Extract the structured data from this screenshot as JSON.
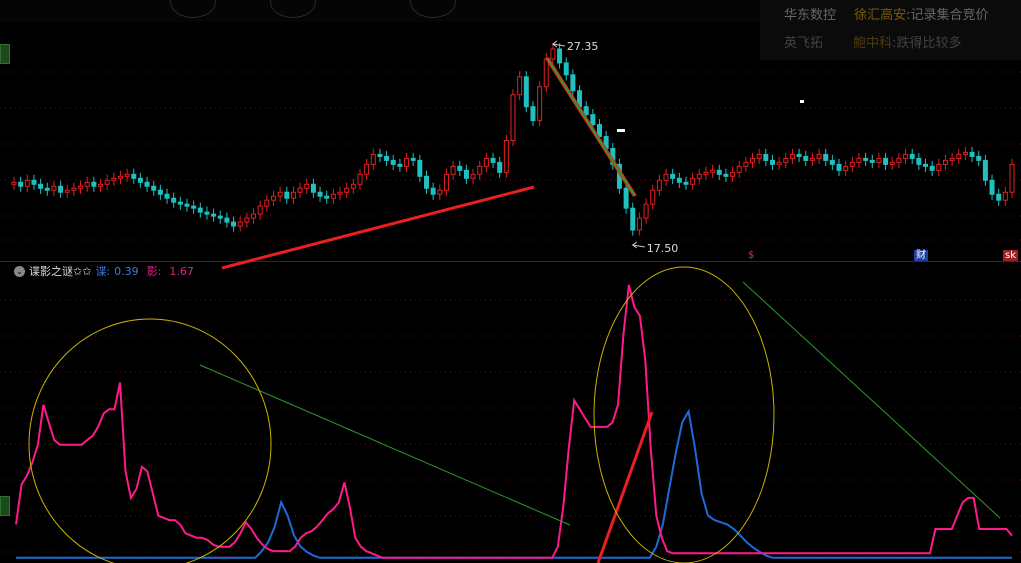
{
  "news_panel": {
    "items": [
      {
        "company": "华东数控",
        "tag": "徐汇高安",
        "text": ":记录集合竞价"
      },
      {
        "company": "英飞拓",
        "tag": "鲍中科",
        "text": ":跌得比较多"
      }
    ]
  },
  "indicator": {
    "name": "谍影之谜✩✩",
    "k1_label": "谍:",
    "k1_value": "0.39",
    "k2_label": "影:",
    "k2_value": "1.67"
  },
  "markers": {
    "dollar": "$",
    "cai": "财",
    "sk": "sk"
  },
  "colors": {
    "up": "#e02020",
    "down": "#20c0c0",
    "trend_red": "#e82020",
    "trend_green": "#2a9a2a",
    "pink": "#ff1a8c",
    "blue": "#1e6ad8",
    "circle": "#c8b400"
  },
  "chart_data": [
    {
      "type": "candlestick",
      "annotations": {
        "high_label": "27.35",
        "low_label": "17.50"
      },
      "closes": [
        20.4,
        20.2,
        20.5,
        20.3,
        20.1,
        20.0,
        20.2,
        19.9,
        20.0,
        20.1,
        20.2,
        20.4,
        20.2,
        20.3,
        20.5,
        20.6,
        20.7,
        20.8,
        20.6,
        20.4,
        20.2,
        20.0,
        19.8,
        19.6,
        19.4,
        19.3,
        19.2,
        19.1,
        18.9,
        18.8,
        18.7,
        18.6,
        18.4,
        18.2,
        18.4,
        18.6,
        18.8,
        19.2,
        19.5,
        19.7,
        19.9,
        19.6,
        19.9,
        20.1,
        20.3,
        19.9,
        19.7,
        19.6,
        19.8,
        19.9,
        20.1,
        20.3,
        20.8,
        21.3,
        21.8,
        21.7,
        21.5,
        21.3,
        21.2,
        21.6,
        21.5,
        20.7,
        20.1,
        19.8,
        20.0,
        20.8,
        21.2,
        21.0,
        20.6,
        20.8,
        21.2,
        21.6,
        21.4,
        20.9,
        22.5,
        24.8,
        25.7,
        24.2,
        23.5,
        25.2,
        26.6,
        27.1,
        26.4,
        25.8,
        25.0,
        24.2,
        23.8,
        23.3,
        22.7,
        22.1,
        21.3,
        20.1,
        19.1,
        18.0,
        18.6,
        19.3,
        20.0,
        20.5,
        20.8,
        20.6,
        20.4,
        20.3,
        20.6,
        20.8,
        20.9,
        21.0,
        20.8,
        20.7,
        20.9,
        21.2,
        21.4,
        21.6,
        21.8,
        21.5,
        21.3,
        21.4,
        21.6,
        21.8,
        21.7,
        21.5,
        21.6,
        21.8,
        21.5,
        21.3,
        21.0,
        21.2,
        21.4,
        21.6,
        21.5,
        21.4,
        21.6,
        21.3,
        21.4,
        21.6,
        21.8,
        21.6,
        21.3,
        21.2,
        21.0,
        21.3,
        21.5,
        21.6,
        21.8,
        21.9,
        21.7,
        21.5,
        20.5,
        19.8,
        19.5,
        19.9,
        21.3
      ]
    },
    {
      "type": "line",
      "series": [
        {
          "name": "谍",
          "values": [
            0.05,
            0.05,
            0.05,
            0.05,
            0.05,
            0.05,
            0.05,
            0.05,
            0.05,
            0.05,
            0.05,
            0.05,
            0.05,
            0.05,
            0.05,
            0.05,
            0.05,
            0.05,
            0.05,
            0.05,
            0.05,
            0.05,
            0.05,
            0.05,
            0.05,
            0.05,
            0.05,
            0.05,
            0.05,
            0.05,
            0.05,
            0.05,
            0.05,
            0.05,
            0.05,
            0.05,
            0.05,
            0.05,
            0.2,
            0.4,
            0.75,
            1.3,
            1.0,
            0.55,
            0.3,
            0.18,
            0.1,
            0.05,
            0.05,
            0.05,
            0.05,
            0.05,
            0.05,
            0.05,
            0.05,
            0.05,
            0.05,
            0.05,
            0.05,
            0.05,
            0.05,
            0.05,
            0.05,
            0.05,
            0.05,
            0.05,
            0.05,
            0.05,
            0.05,
            0.05,
            0.05,
            0.05,
            0.05,
            0.05,
            0.05,
            0.05,
            0.05,
            0.05,
            0.05,
            0.05,
            0.05,
            0.05,
            0.05,
            0.05,
            0.05,
            0.05,
            0.05,
            0.05,
            0.05,
            0.05,
            0.05,
            0.05,
            0.05,
            0.05,
            0.05,
            0.05,
            0.05,
            0.05,
            0.05,
            0.3,
            0.8,
            1.6,
            2.4,
            3.1,
            3.35,
            2.5,
            1.5,
            1.0,
            0.9,
            0.85,
            0.8,
            0.7,
            0.55,
            0.4,
            0.28,
            0.18,
            0.1,
            0.05,
            0.05,
            0.05,
            0.05,
            0.05,
            0.05,
            0.05,
            0.05,
            0.05,
            0.05,
            0.05,
            0.05,
            0.05,
            0.05,
            0.05,
            0.05,
            0.05,
            0.05,
            0.05,
            0.05,
            0.05,
            0.05,
            0.05,
            0.05,
            0.05,
            0.05,
            0.05,
            0.05,
            0.05,
            0.05,
            0.05,
            0.05,
            0.05,
            0.05,
            0.05,
            0.05,
            0.05,
            0.05
          ]
        },
        {
          "name": "影",
          "values": [
            0.8,
            1.7,
            1.9,
            2.2,
            2.6,
            3.5,
            3.1,
            2.7,
            2.6,
            2.6,
            2.6,
            2.6,
            2.6,
            2.7,
            2.8,
            3.0,
            3.3,
            3.4,
            3.4,
            4.0,
            2.0,
            1.4,
            1.6,
            2.1,
            2.0,
            1.5,
            1.0,
            0.95,
            0.9,
            0.9,
            0.8,
            0.6,
            0.55,
            0.5,
            0.5,
            0.45,
            0.35,
            0.3,
            0.3,
            0.3,
            0.4,
            0.6,
            0.85,
            0.7,
            0.5,
            0.35,
            0.25,
            0.2,
            0.2,
            0.2,
            0.2,
            0.3,
            0.5,
            0.6,
            0.65,
            0.75,
            0.9,
            1.05,
            1.15,
            1.3,
            1.75,
            1.2,
            0.5,
            0.3,
            0.2,
            0.15,
            0.1,
            0.05,
            0.05,
            0.05,
            0.05,
            0.05,
            0.05,
            0.05,
            0.05,
            0.05,
            0.05,
            0.05,
            0.05,
            0.05,
            0.05,
            0.05,
            0.05,
            0.05,
            0.05,
            0.05,
            0.05,
            0.05,
            0.05,
            0.05,
            0.05,
            0.05,
            0.05,
            0.05,
            0.05,
            0.05,
            0.05,
            0.05,
            0.05,
            0.3,
            1.2,
            2.5,
            3.6,
            3.4,
            3.2,
            3.0,
            3.0,
            3.0,
            3.0,
            3.1,
            3.5,
            5.1,
            6.2,
            5.7,
            5.5,
            4.5,
            2.5,
            1.0,
            0.5,
            0.2,
            0.15,
            0.15,
            0.15,
            0.15,
            0.15,
            0.15,
            0.15,
            0.15,
            0.15,
            0.15,
            0.15,
            0.15,
            0.15,
            0.15,
            0.15,
            0.15,
            0.15,
            0.15,
            0.15,
            0.15,
            0.15,
            0.15,
            0.15,
            0.15,
            0.15,
            0.15,
            0.15,
            0.15,
            0.15,
            0.15,
            0.15,
            0.15,
            0.15,
            0.15,
            0.15,
            0.15,
            0.15,
            0.15,
            0.15,
            0.15,
            0.15,
            0.15,
            0.15,
            0.15,
            0.15,
            0.15,
            0.15,
            0.15,
            0.7,
            0.7,
            0.7,
            0.7,
            1.0,
            1.3,
            1.4,
            1.4,
            0.7,
            0.7,
            0.7,
            0.7,
            0.7,
            0.7,
            0.55
          ]
        }
      ]
    }
  ]
}
